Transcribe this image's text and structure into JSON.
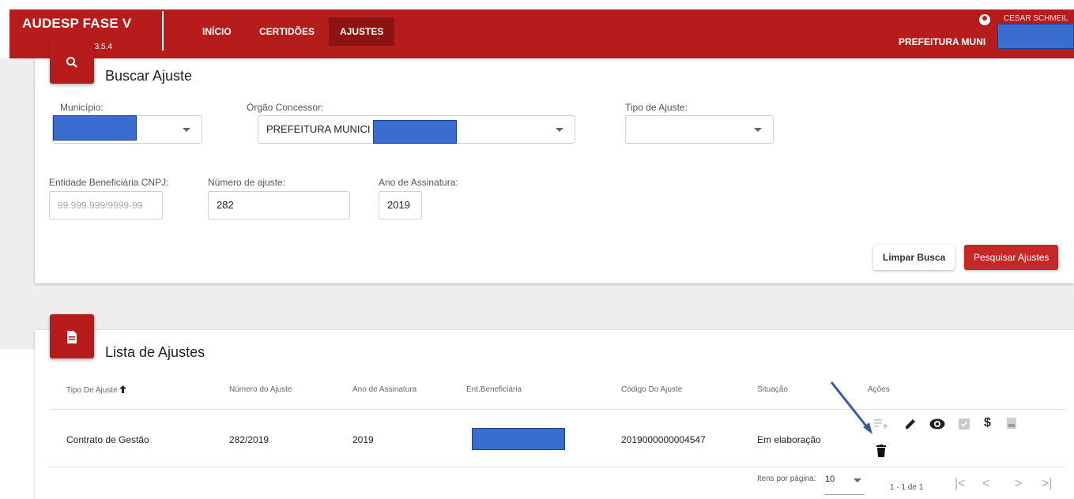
{
  "header": {
    "brand": "AUDESP FASE V",
    "version": "V3.5.4",
    "nav": [
      {
        "label": "INÍCIO"
      },
      {
        "label": "CERTIDÕES"
      },
      {
        "label": "AJUSTES"
      }
    ],
    "user_name": "CESAR SCHMEIL",
    "user_org": "PREFEITURA MUNI",
    "colors": {
      "primary": "#b71c1c",
      "active_nav": "#8d1313",
      "redaction": "#3a6dd0"
    }
  },
  "search": {
    "title": "Buscar Ajuste",
    "icon": "search-icon",
    "municipio_label": "Município:",
    "orgao_label": "Órgão Concessor:",
    "orgao_value": "PREFEITURA MUNICI",
    "tipo_label": "Tipo de Ajuste:",
    "cnpj_label": "Entidade Beneficiária CNPJ:",
    "cnpj_placeholder": "99.999.999/9999-99",
    "numero_label": "Número de ajuste:",
    "numero_value": "282",
    "ano_label": "Ano de Assinatura:",
    "ano_value": "2019",
    "clear_button": "Limpar Busca",
    "search_button": "Pesquisar Ajustes"
  },
  "list": {
    "title": "Lista de Ajustes",
    "icon": "document-icon",
    "columns": [
      "Tipo De Ajuste",
      "Número do Ajuste",
      "Ano de Assinatura",
      "Ent.Beneficiária",
      "Código Do Ajuste",
      "Situação",
      "Ações"
    ],
    "rows": [
      {
        "tipo": "Contrato de Gestão",
        "numero": "282/2019",
        "ano": "2019",
        "codigo": "2019000000004547",
        "situacao": "Em elaboração"
      }
    ],
    "pagination": {
      "items_label": "Itens por página:",
      "page_size": "10",
      "range": "1 - 1 de 1"
    }
  }
}
